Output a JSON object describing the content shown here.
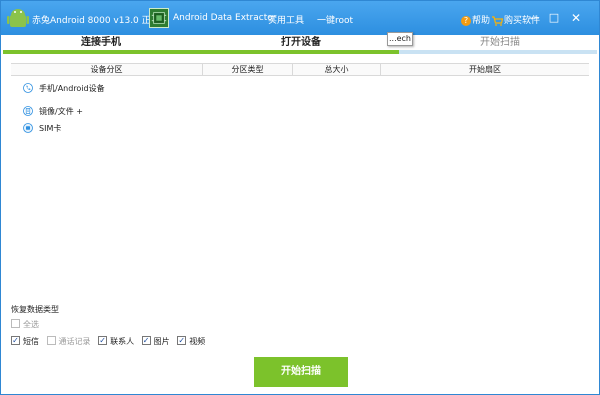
{
  "titlebar": {
    "app_title": "赤兔Android 8000 v13.0 正式版",
    "tool_title": "Android Data Extractor",
    "menu_tools": "实用工具",
    "menu_root": "一键root",
    "help": "帮助",
    "buy": "购买软件",
    "min_glyph": "—",
    "max_glyph": "□",
    "close_glyph": "✕",
    "bg_color": "#3a9ae8"
  },
  "steps": {
    "items": [
      "连接手机",
      "打开设备",
      "开始扫描"
    ],
    "active_index": 1,
    "progress_fraction": 0.667,
    "progress_color": "#7cc22b",
    "track_color": "#c9e2f3"
  },
  "tooltip": "...ech",
  "table": {
    "columns": [
      "设备分区",
      "分区类型",
      "总大小",
      "开始扇区"
    ]
  },
  "tree": [
    {
      "icon": "phone-icon",
      "label": "手机/Android设备"
    },
    {
      "icon": "image-file-icon",
      "label": "镜像/文件 +"
    },
    {
      "icon": "sim-card-icon",
      "label": "SIM卡"
    }
  ],
  "recover": {
    "title": "恢复数据类型",
    "select_all": {
      "label": "全选",
      "checked": false,
      "disabled": true
    },
    "types": [
      {
        "label": "短信",
        "checked": true
      },
      {
        "label": "通话记录",
        "checked": false,
        "disabled": true
      },
      {
        "label": "联系人",
        "checked": true
      },
      {
        "label": "图片",
        "checked": true
      },
      {
        "label": "视频",
        "checked": true
      }
    ]
  },
  "scan_button": "开始扫描"
}
